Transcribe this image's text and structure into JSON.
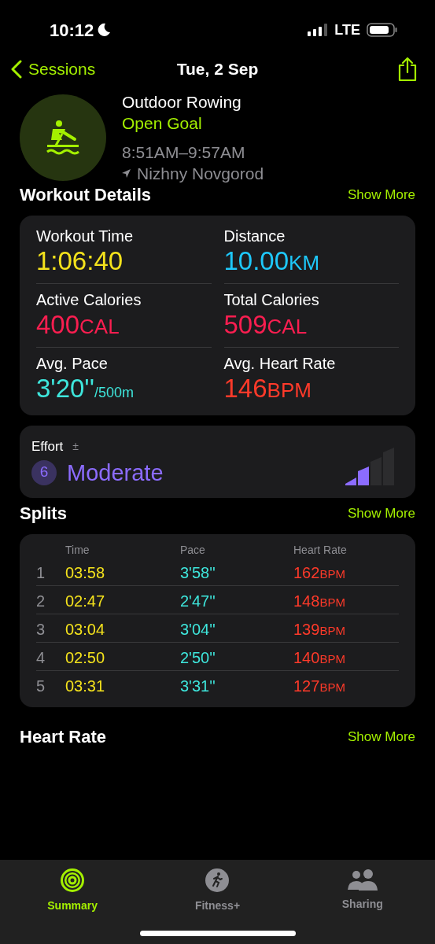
{
  "status_bar": {
    "time": "10:12",
    "network": "LTE"
  },
  "nav": {
    "back": "Sessions",
    "title": "Tue, 2 Sep"
  },
  "workout": {
    "name": "Outdoor Rowing",
    "goal": "Open Goal",
    "time_range": "8:51AM–9:57AM",
    "location": "Nizhny Novgorod"
  },
  "details": {
    "title": "Workout Details",
    "more": "Show More",
    "metrics": [
      {
        "label": "Workout Time",
        "value": "1:06:40",
        "color": "#f4e21c"
      },
      {
        "label": "Distance",
        "value": "10.00",
        "unit": "KM",
        "color": "#1ec8fa"
      },
      {
        "label": "Active Calories",
        "value": "400",
        "unit": "CAL",
        "color": "#fa1e50"
      },
      {
        "label": "Total Calories",
        "value": "509",
        "unit": "CAL",
        "color": "#fa1e50"
      },
      {
        "label": "Avg. Pace",
        "value": "3'20''",
        "suffix": "/500m",
        "color": "#3ee6dc"
      },
      {
        "label": "Avg. Heart Rate",
        "value": "146",
        "unit": "BPM",
        "color": "#ff3a2a"
      }
    ]
  },
  "effort": {
    "label": "Effort",
    "adjust": "±",
    "score": "6",
    "rating": "Moderate",
    "level": 0.5
  },
  "splits": {
    "title": "Splits",
    "more": "Show More",
    "columns": [
      "Time",
      "Pace",
      "Heart Rate"
    ],
    "rows": [
      {
        "index": "1",
        "time": "03:58",
        "pace": "3'58''",
        "heart_rate": "162",
        "unit": "BPM"
      },
      {
        "index": "2",
        "time": "02:47",
        "pace": "2'47''",
        "heart_rate": "148",
        "unit": "BPM"
      },
      {
        "index": "3",
        "time": "03:04",
        "pace": "3'04''",
        "heart_rate": "139",
        "unit": "BPM"
      },
      {
        "index": "4",
        "time": "02:50",
        "pace": "2'50''",
        "heart_rate": "140",
        "unit": "BPM"
      },
      {
        "index": "5",
        "time": "03:31",
        "pace": "3'31''",
        "heart_rate": "127",
        "unit": "BPM"
      }
    ]
  },
  "heart_rate": {
    "title": "Heart Rate",
    "more": "Show More"
  },
  "tabs": [
    {
      "label": "Summary",
      "kind": "rings",
      "selected": true
    },
    {
      "label": "Fitness+",
      "kind": "runner",
      "selected": false
    },
    {
      "label": "Sharing",
      "kind": "people",
      "selected": false
    }
  ]
}
